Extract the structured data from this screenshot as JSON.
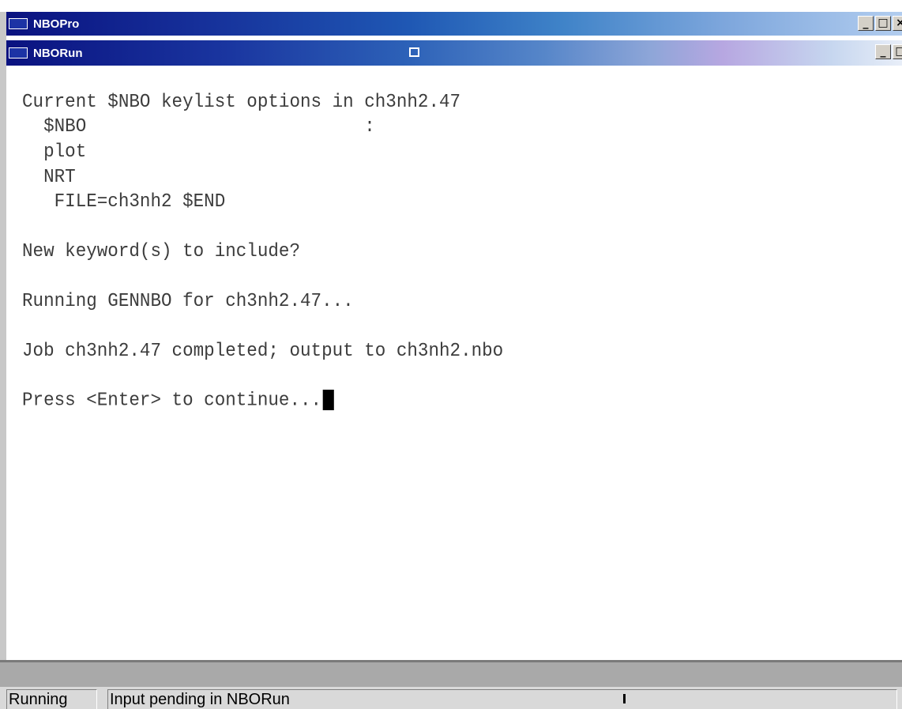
{
  "outer_window": {
    "title": "NBOPro",
    "buttons": [
      "_",
      "□",
      "×"
    ]
  },
  "inner_window": {
    "title": "NBORun",
    "buttons": [
      "_",
      "□"
    ]
  },
  "console": {
    "lines": [
      "Current $NBO keylist options in ch3nh2.47",
      "  $NBO                          :",
      "  plot",
      "  NRT",
      "   FILE=ch3nh2 $END",
      "",
      "New keyword(s) to include?",
      "",
      "Running GENNBO for ch3nh2.47...",
      "",
      "Job ch3nh2.47 completed; output to ch3nh2.nbo",
      "",
      "Press <Enter> to continue..."
    ]
  },
  "statusbar": {
    "state": "Running",
    "message": "Input pending in NBORun"
  },
  "colors": {
    "console_text": "#3c3c3c",
    "titlebar_start": "#0a1280",
    "titlebar_end": "#b2cdef"
  }
}
